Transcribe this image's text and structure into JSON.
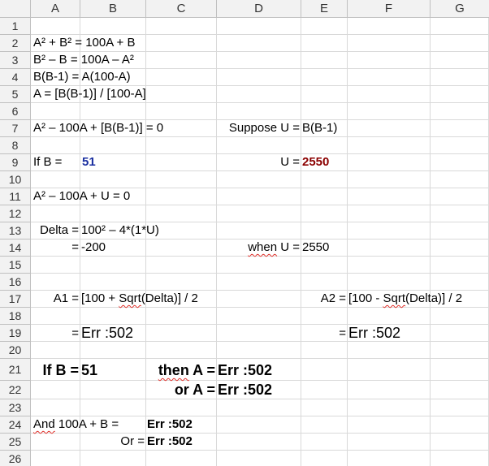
{
  "columns": [
    "A",
    "B",
    "C",
    "D",
    "E",
    "F",
    "G"
  ],
  "rows": [
    "1",
    "2",
    "3",
    "4",
    "5",
    "6",
    "7",
    "8",
    "9",
    "10",
    "11",
    "12",
    "13",
    "14",
    "15",
    "16",
    "17",
    "18",
    "19",
    "20",
    "21",
    "22",
    "23",
    "24",
    "25",
    "26"
  ],
  "cells": {
    "a2": "A² + B² = 100A + B",
    "a3": "B² – B = 100A – A²",
    "a4": "B(B-1) = A(100-A)",
    "a5": "A = [B(B-1)] / [100-A]",
    "a7": "A² – 100A + [B(B-1)] = 0",
    "d7": "Suppose U =",
    "e7": "B(B-1)",
    "a9": "If B =",
    "b9": "51",
    "d9": "U =",
    "e9": "2550",
    "a11": "A² – 100A + U = 0",
    "a13": "Delta =",
    "b13": "100² – 4*(1*U)",
    "a14": "=",
    "b14": "-200",
    "d14_word": "when",
    "d14_rest": " U =",
    "e14": "2550",
    "a17": "A1 =",
    "b17_pre": "[100 + ",
    "b17_sqrt": "Sqrt",
    "b17_post": "(Delta)] / 2",
    "e17": "A2 =",
    "f17_pre": "[100 - ",
    "f17_sqrt": "Sqrt",
    "f17_post": "(Delta)] / 2",
    "a19": "=",
    "b19": "Err :502",
    "e19": "=",
    "f19": "Err :502",
    "a21": "If B =",
    "b21": "51",
    "c21_word": "then",
    "c21_rest": " A =",
    "d21": "Err :502",
    "c22": "or A =",
    "d22": "Err :502",
    "a24_word": "And",
    "a24_rest": " 100A + B =",
    "c24": "Err :502",
    "b25": "Or =",
    "c25": "Err :502"
  },
  "colors": {
    "blue_value": "#1a2fa0",
    "darkred_value": "#8b0000",
    "spellcheck": "#e0302a"
  }
}
